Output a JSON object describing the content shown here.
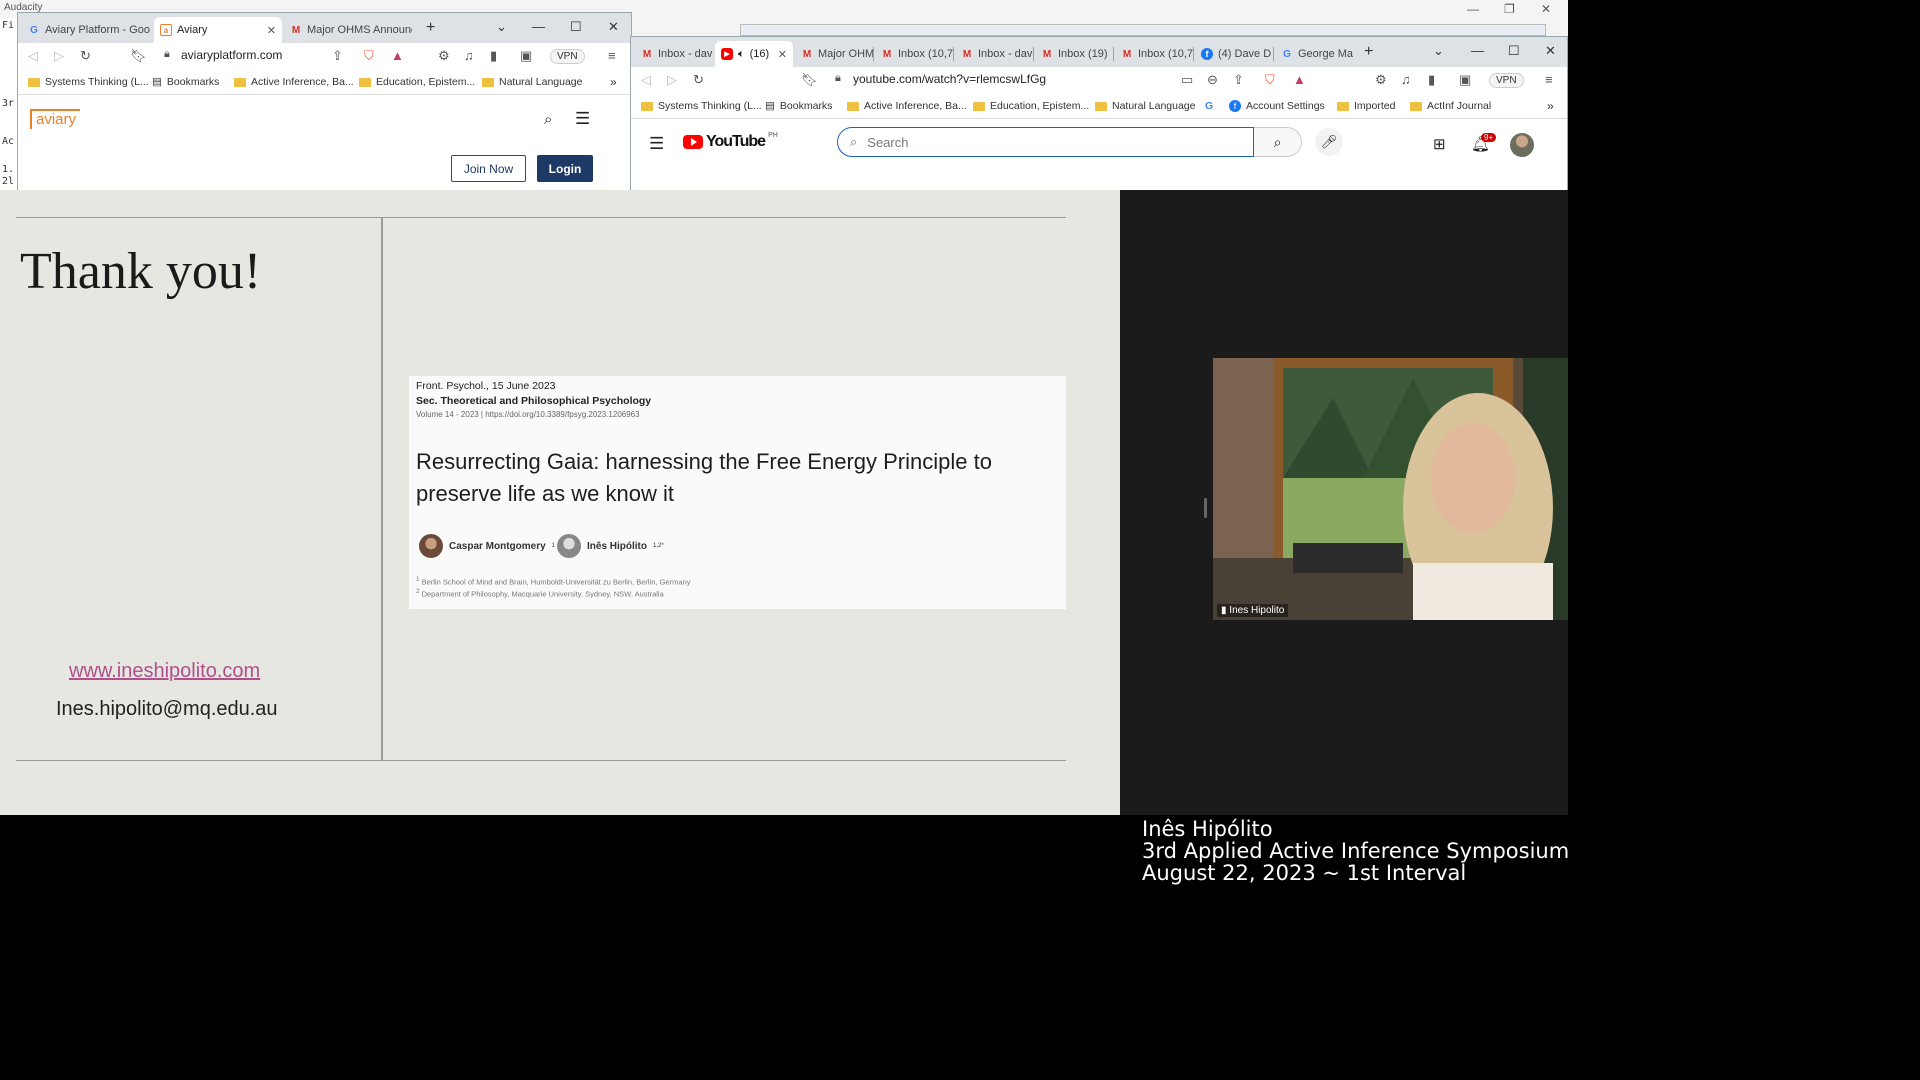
{
  "desktop": {
    "background_app_title": "Audacity",
    "audacity_fragments": [
      "Fi",
      "3r",
      "Ac",
      "1.",
      "2l",
      "Fi"
    ],
    "controls": {
      "minimize": "—",
      "restore": "❐",
      "close": "✕"
    }
  },
  "aviary_window": {
    "tabs": [
      {
        "label": "Aviary Platform - Goog",
        "icon": "google-icon"
      },
      {
        "label": "Aviary",
        "icon": "aviary-icon",
        "active": true
      },
      {
        "label": "Major OHMS Announc",
        "icon": "gmail-icon"
      }
    ],
    "url": "aviaryplatform.com",
    "vpn_label": "VPN",
    "bookmarks": [
      "Systems Thinking (L...",
      "Bookmarks",
      "Active Inference, Ba...",
      "Education, Epistem...",
      "Natural Language"
    ],
    "logo_text": "aviary",
    "join_label": "Join Now",
    "login_label": "Login"
  },
  "youtube_window": {
    "tabs": [
      {
        "label": "Inbox - dav",
        "icon": "gmail-icon"
      },
      {
        "label": "(16)",
        "icon": "youtube-icon",
        "active": true
      },
      {
        "label": "Major OHM",
        "icon": "gmail-icon"
      },
      {
        "label": "Inbox (10,7",
        "icon": "gmail-icon"
      },
      {
        "label": "Inbox - dav",
        "icon": "gmail-icon"
      },
      {
        "label": "Inbox (19)",
        "icon": "gmail-icon"
      },
      {
        "label": "Inbox (10,7",
        "icon": "gmail-icon"
      },
      {
        "label": "(4) Dave D",
        "icon": "facebook-icon"
      },
      {
        "label": "George Ma",
        "icon": "google-icon"
      }
    ],
    "url": "youtube.com/watch?v=rlemcswLfGg",
    "vpn_label": "VPN",
    "bookmarks": [
      "Systems Thinking (L...",
      "Bookmarks",
      "Active Inference, Ba...",
      "Education, Epistem...",
      "Natural Language",
      "Account Settings",
      "Imported",
      "ActInf Journal"
    ],
    "logo_text": "YouTube",
    "region": "PH",
    "search_placeholder": "Search",
    "notification_count": "9+"
  },
  "slide": {
    "title": "Thank you!",
    "website": "www.ineshipolito.com",
    "email": "Ines.hipolito@mq.edu.au",
    "paper": {
      "journal_line": "Front. Psychol., 15 June 2023",
      "section_line": "Sec. Theoretical and Philosophical Psychology",
      "volume_line": "Volume 14 - 2023 | https://doi.org/10.3389/fpsyg.2023.1206963",
      "title": "Resurrecting Gaia: harnessing the Free Energy Principle to preserve life as we know it",
      "authors": [
        {
          "name": "Caspar Montgomery",
          "sup": "1"
        },
        {
          "name": "Inês Hipólito",
          "sup": "1,2*"
        }
      ],
      "affiliations": [
        {
          "num": "1",
          "text": "Berlin School of Mind and Brain, Humboldt-Universität zu Berlin, Berlin, Germany"
        },
        {
          "num": "2",
          "text": "Department of Philosophy, Macquarie University, Sydney, NSW, Australia"
        }
      ]
    }
  },
  "video": {
    "participant_label": "Ines Hipolito"
  },
  "caption": {
    "line1": "Inês Hipólito",
    "line2": "3rd Applied Active Inference Symposium",
    "line3": "August 22, 2023 ~ 1st Interval"
  }
}
